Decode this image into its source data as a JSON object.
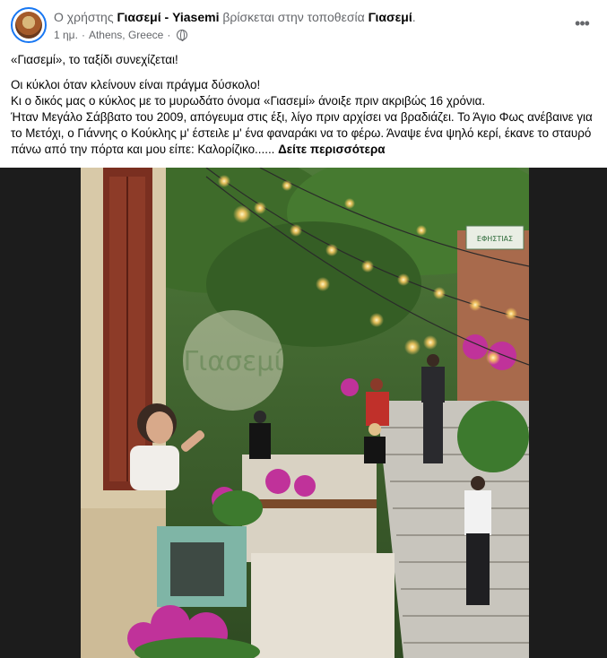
{
  "post": {
    "author_prefix": "Ο χρήστης",
    "author_name": "Γιασεμί - Yiasemi",
    "location_phrase": "βρίσκεται στην τοποθεσία",
    "location_name": "Γιασεμί",
    "location_suffix": ".",
    "time": "1 ημ.",
    "place": "Athens, Greece",
    "more_icon": "three-dots-icon",
    "privacy_icon": "globe-icon",
    "text": [
      "«Γιασεμί», το ταξίδι συνεχίζεται!",
      "Οι κύκλοι όταν κλείνουν είναι πράγμα δύσκολο!",
      "Κι ο δικός μας ο κύκλος με το μυρωδάτο όνομα «Γιασεμί» άνοιξε πριν ακριβώς 16 χρόνια.",
      "Ήταν Μεγάλο Σάββατο του 2009, απόγευμα στις έξι, λίγο πριν αρχίσει να βραδιάζει. Το Άγιο Φως ανέβαινε για το Μετόχι, ο Γιάννης ο Κούκλης μ' έστειλε μ' ένα φαναράκι να το φέρω. Άναψε ένα ψηλό κερί, έκανε το σταυρό πάνω από την πόρτα και μου είπε: Καλορίζικο......"
    ],
    "see_more": "Δείτε περισσότερα"
  },
  "photo": {
    "watermark": "Γιασεμί",
    "sign": "ΕΦΗΣΤΙΑΣ"
  }
}
